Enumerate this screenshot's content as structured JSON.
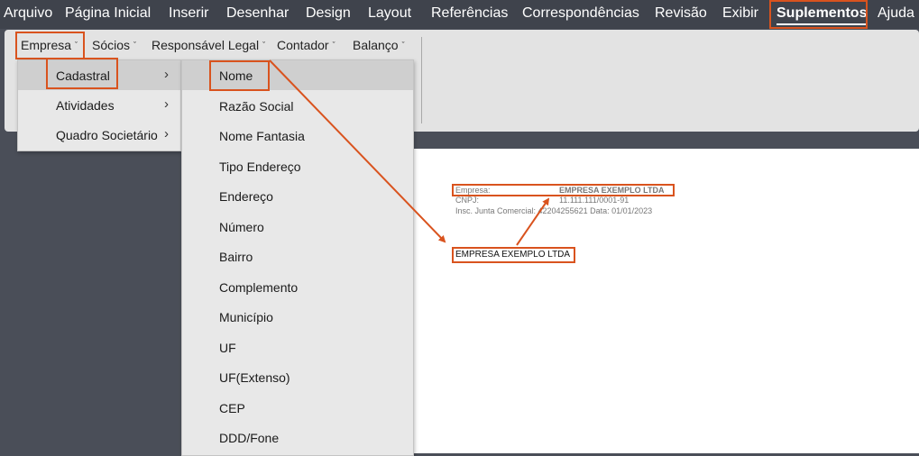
{
  "menubar": {
    "items": [
      "Arquivo",
      "Página Inicial",
      "Inserir",
      "Desenhar",
      "Design",
      "Layout",
      "Referências",
      "Correspondências",
      "Revisão",
      "Exibir",
      "Suplementos",
      "Ajuda"
    ],
    "active": "Suplementos"
  },
  "ribbon": {
    "buttons": [
      "Empresa",
      "Sócios",
      "Responsável Legal",
      "Contador",
      "Balanço"
    ]
  },
  "submenu_empresa": {
    "items": [
      "Cadastral",
      "Atividades",
      "Quadro Societário"
    ],
    "selected": "Cadastral"
  },
  "submenu_cadastral": {
    "items": [
      "Nome",
      "Razão Social",
      "Nome Fantasia",
      "Tipo Endereço",
      "Endereço",
      "Número",
      "Bairro",
      "Complemento",
      "Município",
      "UF",
      "UF(Extenso)",
      "CEP",
      "DDD/Fone"
    ],
    "selected": "Nome"
  },
  "document": {
    "empresa_label": "Empresa:",
    "empresa_value": "EMPRESA EXEMPLO LTDA",
    "cnpj_label": "CNPJ:",
    "cnpj_value": "11.111.111/0001-91",
    "insc_line": "Insc. Junta Comercial: 42204255621 Data: 01/01/2023",
    "inserted_field": "EMPRESA EXEMPLO LTDA"
  },
  "colors": {
    "highlight": "#d9531e",
    "menubar_bg": "#3f434c",
    "ribbon_bg": "#e3e3e3",
    "menu_bg": "#e8e8e8",
    "menu_selected": "#cfcfcf"
  }
}
